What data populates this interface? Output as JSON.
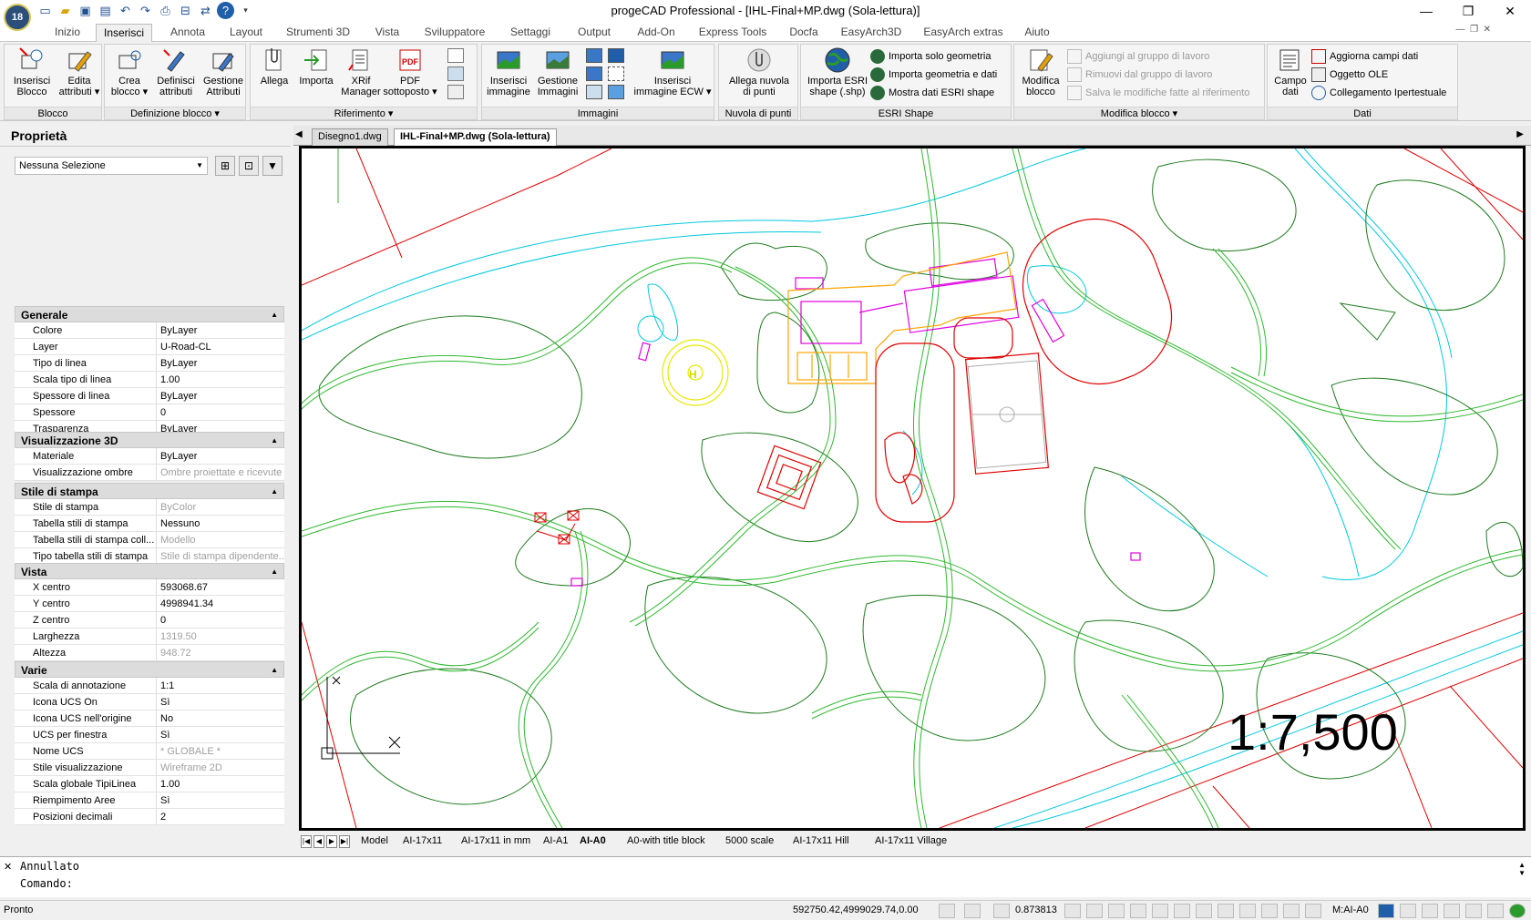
{
  "app": {
    "title": "progeCAD Professional - [IHL-Final+MP.dwg (Sola-lettura)]",
    "logo_badge": "18"
  },
  "window_controls": [
    "—",
    "❐",
    "✕"
  ],
  "ribbon_tabs": [
    "Inizio",
    "Inserisci",
    "Annota",
    "Layout",
    "Strumenti 3D",
    "Vista",
    "Sviluppatore",
    "Settaggi",
    "Output",
    "Add-On",
    "Express Tools",
    "Docfa",
    "EasyArch3D",
    "EasyArch extras",
    "Aiuto"
  ],
  "ribbon_tab_active": "Inserisci",
  "ribbon_groups": {
    "blocco": {
      "label": "Blocco",
      "buttons": [
        {
          "line1": "Inserisci",
          "line2": "Blocco"
        },
        {
          "line1": "Edita",
          "line2": "attributi ▾"
        }
      ]
    },
    "definizione": {
      "label": "Definizione blocco ▾",
      "buttons": [
        {
          "line1": "Crea",
          "line2": "blocco ▾"
        },
        {
          "line1": "Definisci",
          "line2": "attributi"
        },
        {
          "line1": "Gestione",
          "line2": "Attributi"
        }
      ]
    },
    "riferimento": {
      "label": "Riferimento ▾",
      "buttons": [
        {
          "line1": "Allega",
          "line2": ""
        },
        {
          "line1": "Importa",
          "line2": ""
        },
        {
          "line1": "XRif",
          "line2": "Manager"
        },
        {
          "line1": "PDF",
          "line2": "sottoposto ▾"
        }
      ]
    },
    "immagini": {
      "label": "Immagini",
      "buttons": [
        {
          "line1": "Inserisci",
          "line2": "immagine"
        },
        {
          "line1": "Gestione",
          "line2": "Immagini"
        },
        {
          "line1": "Inserisci",
          "line2": "immagine ECW ▾"
        }
      ]
    },
    "nuvola": {
      "label": "Nuvola di punti",
      "buttons": [
        {
          "line1": "Allega nuvola",
          "line2": "di punti"
        }
      ]
    },
    "esri": {
      "label": "ESRI Shape",
      "buttons": [
        {
          "line1": "Importa ESRI",
          "line2": "shape (.shp)"
        }
      ],
      "small": [
        "Importa solo geometria",
        "Importa geometria e dati",
        "Mostra dati ESRI shape"
      ]
    },
    "modifica": {
      "label": "Modifica blocco ▾",
      "buttons": [
        {
          "line1": "Modifica",
          "line2": "blocco"
        }
      ],
      "small": [
        "Aggiungi al gruppo di lavoro",
        "Rimuovi dal gruppo di lavoro",
        "Salva le modifiche fatte al riferimento"
      ]
    },
    "dati": {
      "label": "Dati",
      "buttons": [
        {
          "line1": "Campo",
          "line2": "dati"
        }
      ],
      "small": [
        "Aggiorna campi dati",
        "Oggetto OLE",
        "Collegamento Ipertestuale"
      ]
    }
  },
  "properties": {
    "title": "Proprietà",
    "selection": "Nessuna Selezione",
    "sections": [
      {
        "name": "Generale",
        "rows": [
          [
            "Colore",
            "ByLayer"
          ],
          [
            "Layer",
            "U-Road-CL"
          ],
          [
            "Tipo di linea",
            "ByLayer"
          ],
          [
            "Scala tipo di linea",
            "1.00"
          ],
          [
            "Spessore di linea",
            "ByLayer"
          ],
          [
            "Spessore",
            "0"
          ],
          [
            "Trasparenza",
            "ByLayer"
          ]
        ]
      },
      {
        "name": "Visualizzazione 3D",
        "rows": [
          [
            "Materiale",
            "ByLayer"
          ],
          [
            "Visualizzazione ombre",
            "Ombre proiettate e ricevute"
          ]
        ]
      },
      {
        "name": "Stile di stampa",
        "rows": [
          [
            "Stile di stampa",
            "ByColor"
          ],
          [
            "Tabella stili di stampa",
            "Nessuno"
          ],
          [
            "Tabella stili di stampa coll...",
            "Modello"
          ],
          [
            "Tipo tabella stili di stampa",
            "Stile di stampa dipendente..."
          ]
        ]
      },
      {
        "name": "Vista",
        "rows": [
          [
            "X centro",
            "593068.67"
          ],
          [
            "Y centro",
            "4998941.34"
          ],
          [
            "Z centro",
            "0"
          ],
          [
            "Larghezza",
            "1319.50"
          ],
          [
            "Altezza",
            "948.72"
          ]
        ]
      },
      {
        "name": "Varie",
        "rows": [
          [
            "Scala di annotazione",
            "1:1"
          ],
          [
            "Icona UCS On",
            "Sì"
          ],
          [
            "Icona UCS nell'origine",
            "No"
          ],
          [
            "UCS per finestra",
            "Sì"
          ],
          [
            "Nome UCS",
            "* GLOBALE *"
          ],
          [
            "Stile visualizzazione",
            "Wireframe 2D"
          ],
          [
            "Scala globale TipiLinea",
            "1.00"
          ],
          [
            "Riempimento Aree",
            "Sì"
          ],
          [
            "Posizioni decimali",
            "2"
          ]
        ]
      }
    ]
  },
  "doc_tabs": [
    "Disegno1.dwg",
    "IHL-Final+MP.dwg (Sola-lettura)"
  ],
  "doc_tab_active": 1,
  "drawing": {
    "scale_label": "1:7,500",
    "helipad_label": "H"
  },
  "layout_tabs": [
    "Model",
    "AI-17x11",
    "AI-17x11 in mm",
    "AI-A1",
    "AI-A0",
    "A0-with title block",
    "5000 scale",
    "AI-17x11 Hill",
    "AI-17x11 Village"
  ],
  "layout_tab_active": "AI-A0",
  "command": {
    "history": "Annullato",
    "prompt": "Comando:"
  },
  "status": {
    "state": "Pronto",
    "coords": "592750.42,4999029.74,0.00",
    "value": "0.873813",
    "layout": "M:AI-A0"
  },
  "colors": {
    "road": "#2eb82e",
    "contour": "#1e7a1e",
    "boundary": "#e00000",
    "water": "#00c8e0",
    "building": "#e000e0",
    "helipad": "#e8e800",
    "orange": "#ffa500"
  }
}
